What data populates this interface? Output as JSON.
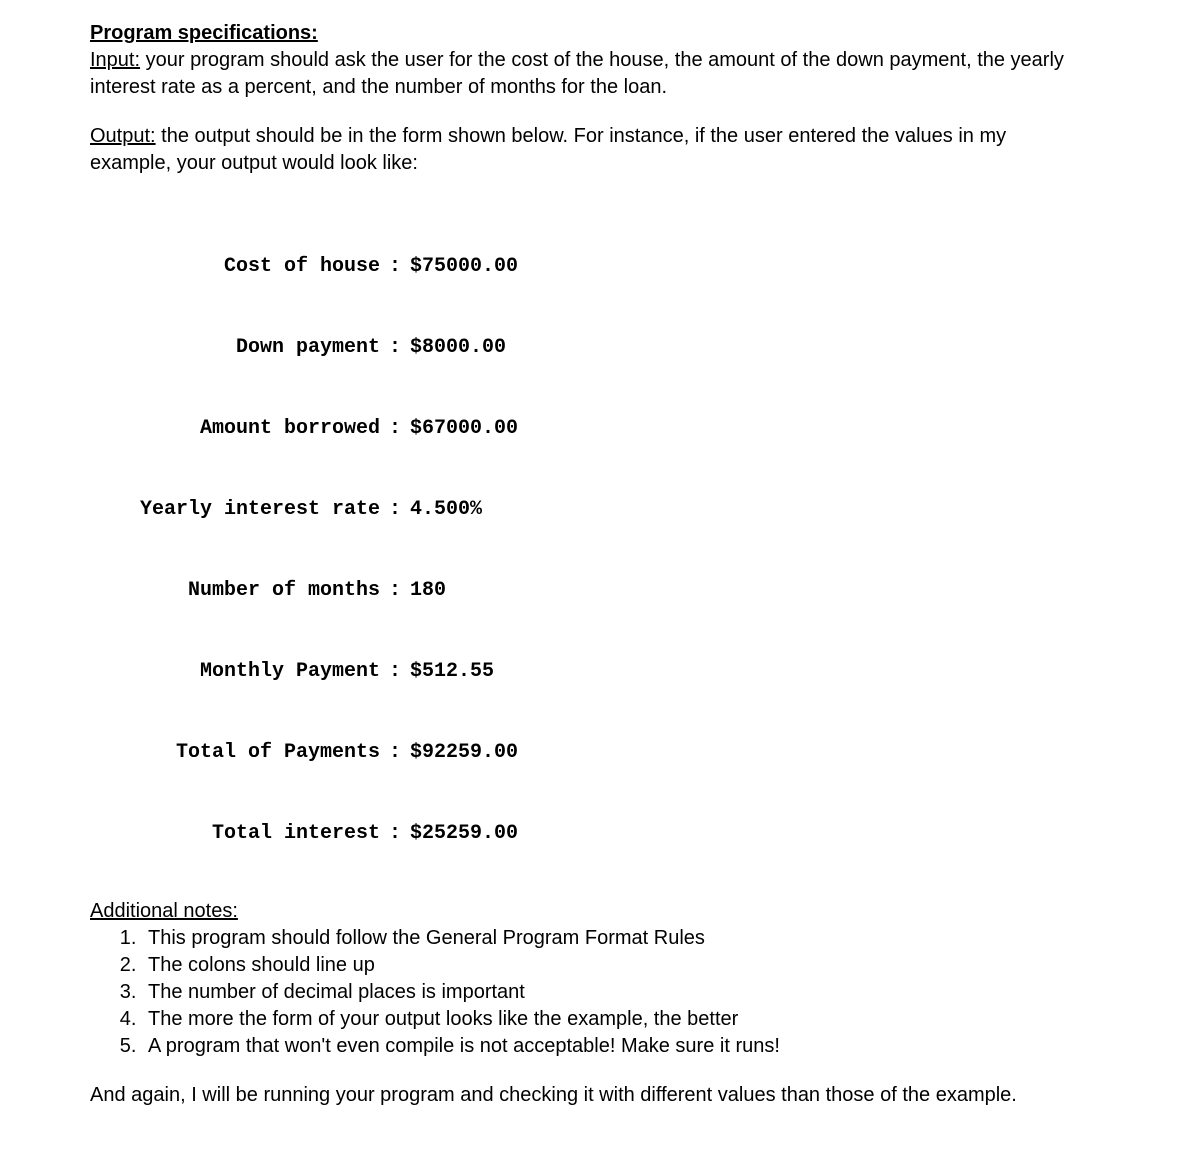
{
  "headings": {
    "spec": "Program specifications:",
    "input": "Input:",
    "output": "Output:",
    "notes": "Additional notes:"
  },
  "paragraphs": {
    "input_body": " your program should ask the user for the cost of the house, the amount of the down payment, the yearly interest rate as a percent, and the number of months for the loan.",
    "output_body": " the output should be in the form shown below. For instance, if the user entered the values in my example, your output would look like:",
    "closing": "And again, I will be running your program and checking it with different values than those of the example."
  },
  "output_rows": [
    {
      "label": "Cost of house",
      "value": "$75000.00"
    },
    {
      "label": "Down payment",
      "value": "$8000.00"
    },
    {
      "label": "Amount borrowed",
      "value": "$67000.00"
    },
    {
      "label": "Yearly interest rate",
      "value": "4.500%"
    },
    {
      "label": "Number of months",
      "value": "180"
    },
    {
      "label": "Monthly Payment",
      "value": "$512.55"
    },
    {
      "label": "Total of Payments",
      "value": "$92259.00"
    },
    {
      "label": "Total interest",
      "value": "$25259.00"
    }
  ],
  "notes": [
    "This program should follow the General Program Format Rules",
    "The colons should line up",
    "The number of decimal places is important",
    "The more the form of your output looks like the example, the better",
    "A program that won't even compile is not acceptable! Make sure it runs!"
  ]
}
